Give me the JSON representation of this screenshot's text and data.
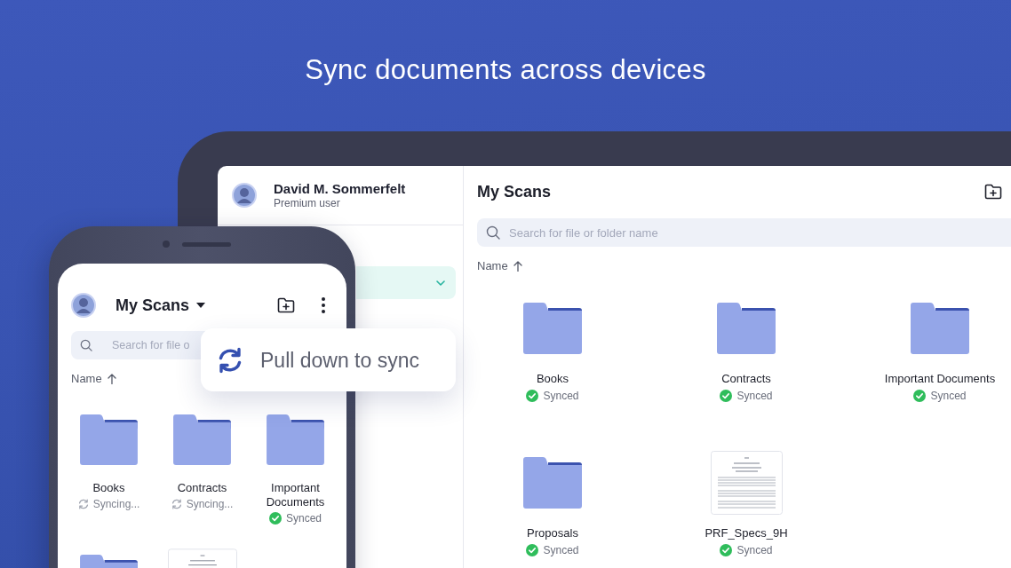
{
  "headline": "Sync documents across devices",
  "tablet": {
    "profile": {
      "name": "David M. Sommerfelt",
      "subtitle": "Premium user"
    },
    "sidebar": {
      "items": [
        {
          "selected": true
        }
      ]
    },
    "title": "My Scans",
    "search": {
      "placeholder": "Search for file or folder name"
    },
    "sort": {
      "label": "Name",
      "ascending": true
    },
    "items": [
      {
        "kind": "folder",
        "name": "Books",
        "status": "Synced",
        "synced": true
      },
      {
        "kind": "folder",
        "name": "Contracts",
        "status": "Synced",
        "synced": true
      },
      {
        "kind": "folder",
        "name": "Important Documents",
        "status": "Synced",
        "synced": true
      },
      {
        "kind": "folder",
        "name": "Proposals",
        "status": "Synced",
        "synced": true
      },
      {
        "kind": "document",
        "name": "PRF_Specs_9H",
        "status": "Synced",
        "synced": true
      }
    ]
  },
  "phone": {
    "title": "My Scans",
    "search": {
      "placeholder": "Search for file o"
    },
    "sort": {
      "label": "Name",
      "ascending": true
    },
    "items": [
      {
        "kind": "folder",
        "name": "Books",
        "status": "Syncing...",
        "synced": false
      },
      {
        "kind": "folder",
        "name": "Contracts",
        "status": "Syncing...",
        "synced": false
      },
      {
        "kind": "folder",
        "name": "Important Documents",
        "status": "Synced",
        "synced": true
      },
      {
        "kind": "folder"
      },
      {
        "kind": "document"
      }
    ]
  },
  "toast": {
    "text": "Pull down to sync"
  }
}
